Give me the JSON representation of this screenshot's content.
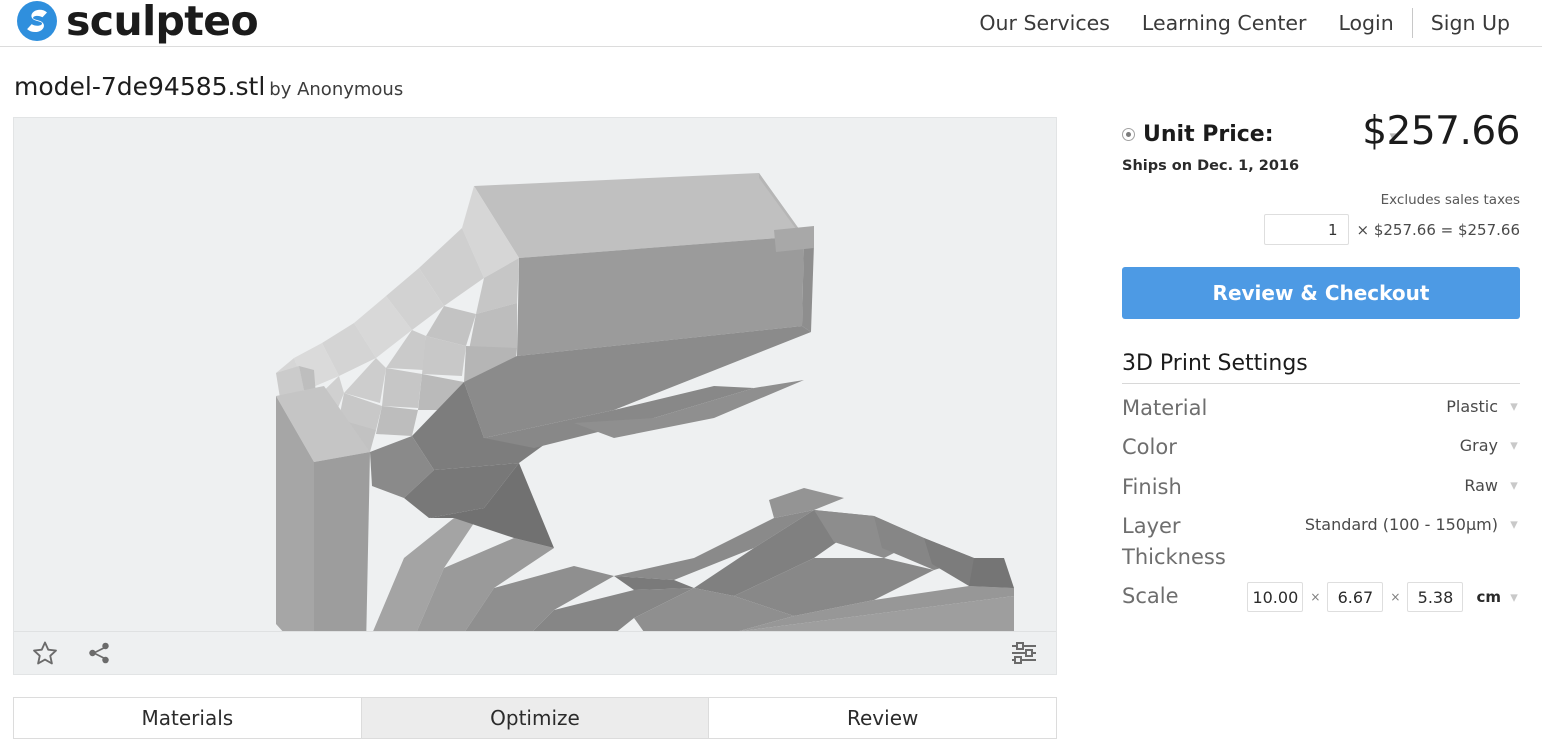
{
  "brand": {
    "name": "sculpteo",
    "logo_color": "#2f8fdd"
  },
  "nav": {
    "items": [
      {
        "label": "Our Services"
      },
      {
        "label": "Learning Center"
      },
      {
        "label": "Login"
      },
      {
        "label": "Sign Up"
      }
    ]
  },
  "title": {
    "model_name": "model-7de94585.stl",
    "by": "by Anonymous"
  },
  "viewer": {
    "background": "#eef0f1",
    "icons": {
      "favorite": "star-icon",
      "share": "share-icon",
      "settings": "sliders-icon"
    }
  },
  "tabs": [
    {
      "label": "Materials",
      "active": false
    },
    {
      "label": "Optimize",
      "active": true
    },
    {
      "label": "Review",
      "active": false
    }
  ],
  "price": {
    "label": "Unit Price:",
    "value": "$257.66",
    "ships": "Ships on Dec. 1, 2016",
    "excludes_taxes": "Excludes sales taxes",
    "quantity": "1",
    "quantity_placeholder": "1",
    "math": "× $257.66 = $257.66",
    "multiply_symbol": "×",
    "unit_price": "$257.66",
    "equals_symbol": "=",
    "total": "$257.66",
    "checkout_label": "Review & Checkout",
    "checkout_color": "#4d9ae4"
  },
  "settings": {
    "title": "3D Print Settings",
    "rows": [
      {
        "label": "Material",
        "value": "Plastic"
      },
      {
        "label": "Color",
        "value": "Gray"
      },
      {
        "label": "Finish",
        "value": "Raw"
      },
      {
        "label": "Layer Thickness",
        "value": "Standard (100 - 150µm)"
      }
    ],
    "scale": {
      "label": "Scale",
      "x": "10.00",
      "y": "6.67",
      "z": "5.38",
      "unit": "cm",
      "sep": "×"
    }
  }
}
